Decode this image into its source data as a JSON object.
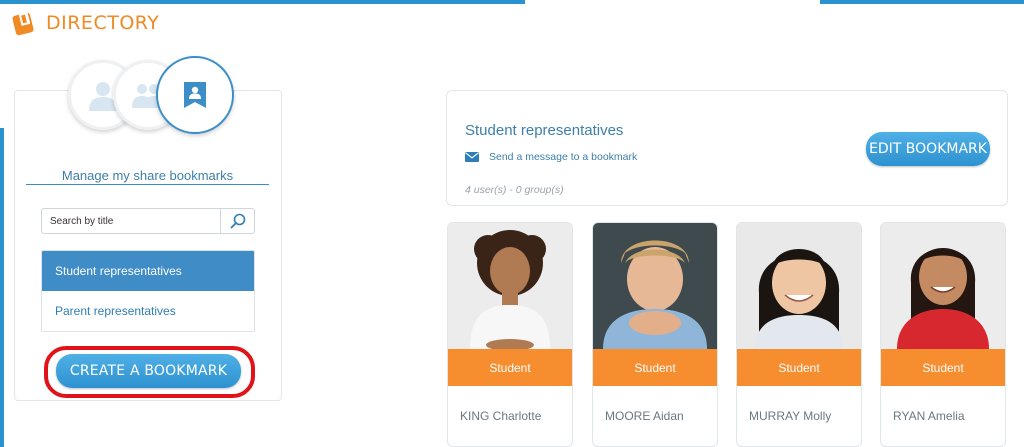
{
  "app": {
    "title": "DIRECTORY"
  },
  "left_panel": {
    "section_title": "Manage my share bookmarks",
    "search": {
      "placeholder": "Search by title",
      "value": ""
    },
    "bookmarks": [
      {
        "label": "Student representatives",
        "active": true
      },
      {
        "label": "Parent representatives",
        "active": false
      }
    ],
    "create_label": "CREATE A BOOKMARK"
  },
  "bookmark_detail": {
    "title": "Student representatives",
    "message_link": "Send a message to a bookmark",
    "counts": "4 user(s) - 0 group(s)",
    "edit_label": "EDIT BOOKMARK"
  },
  "members": [
    {
      "role": "Student",
      "name": "KING Charlotte"
    },
    {
      "role": "Student",
      "name": "MOORE Aidan"
    },
    {
      "role": "Student",
      "name": "MURRAY Molly"
    },
    {
      "role": "Student",
      "name": "RYAN Amelia"
    }
  ],
  "colors": {
    "accent_blue": "#2a93cf",
    "brand_orange": "#f08a24",
    "role_orange": "#f68d2e",
    "highlight_red": "#e0131a",
    "active_item": "#3f8cc6"
  },
  "icons": {
    "logo": "book-logo-icon",
    "users_tab": "user-icon",
    "groups_tab": "group-icon",
    "bookmarks_tab": "bookmark-icon",
    "search": "search-icon",
    "message": "envelope-icon"
  }
}
